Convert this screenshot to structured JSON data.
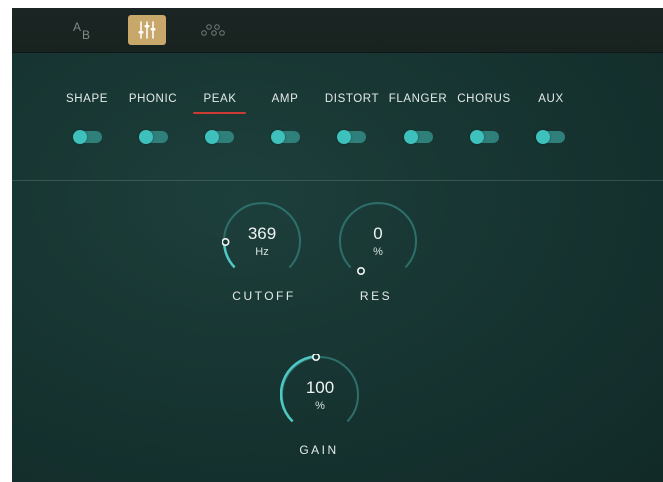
{
  "toolbar": {
    "ab_icon": "ab-compare-icon",
    "mixer_icon": "mixer-sliders-icon",
    "dots_icon": "routing-dots-icon",
    "ab_label_a": "A",
    "ab_label_b": "B",
    "active_color": "#c8a86a"
  },
  "tabs": [
    {
      "label": "SHAPE",
      "active": false
    },
    {
      "label": "PHONIC",
      "active": false
    },
    {
      "label": "PEAK",
      "active": true
    },
    {
      "label": "AMP",
      "active": false
    },
    {
      "label": "DISTORT",
      "active": false
    },
    {
      "label": "FLANGER",
      "active": false
    },
    {
      "label": "CHORUS",
      "active": false
    },
    {
      "label": "AUX",
      "active": false
    }
  ],
  "accent_color": "#cc3a34",
  "toggle_color": "#3ec1bd",
  "knobs": {
    "cutoff": {
      "value": "369",
      "unit": "Hz",
      "label": "CUTOFF"
    },
    "res": {
      "value": "0",
      "unit": "%",
      "label": "RES"
    },
    "gain": {
      "value": "100",
      "unit": "%",
      "label": "GAIN"
    }
  }
}
